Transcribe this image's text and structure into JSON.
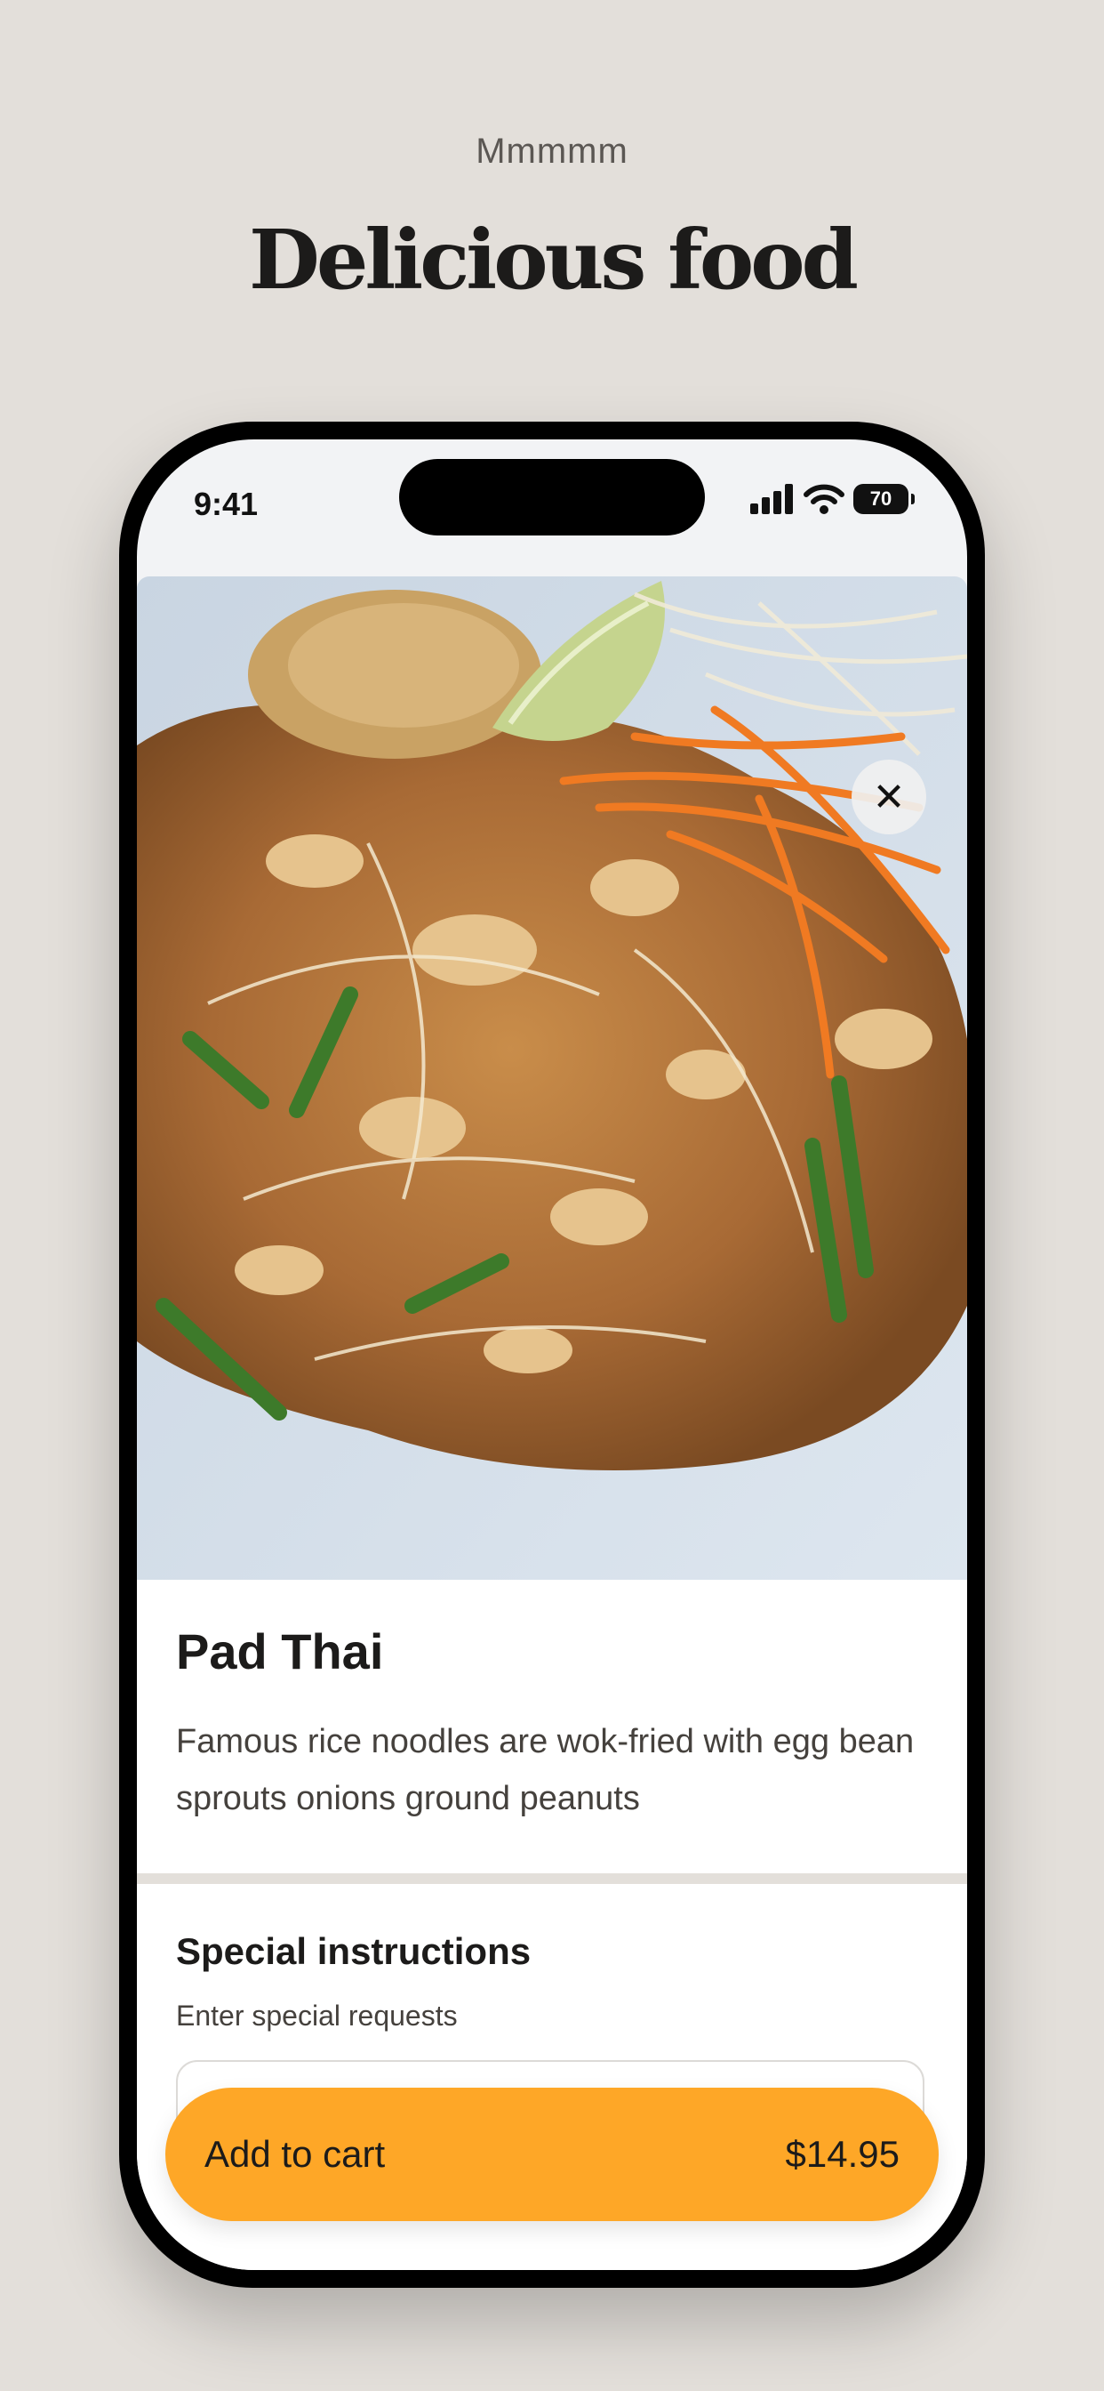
{
  "header": {
    "eyebrow": "Mmmmm",
    "title": "Delicious food"
  },
  "status_bar": {
    "time": "9:41",
    "battery": "70"
  },
  "item": {
    "name": "Pad Thai",
    "description": "Famous rice noodles are wok-fried with egg bean sprouts onions ground peanuts",
    "close_icon": "close-icon"
  },
  "instructions": {
    "title": "Special instructions",
    "subtitle": "Enter special requests",
    "value": ""
  },
  "cart_button": {
    "label": "Add to cart",
    "price": "$14.95"
  },
  "colors": {
    "background": "#e3dfda",
    "accent": "#fea727",
    "text": "#1c1b1a"
  }
}
